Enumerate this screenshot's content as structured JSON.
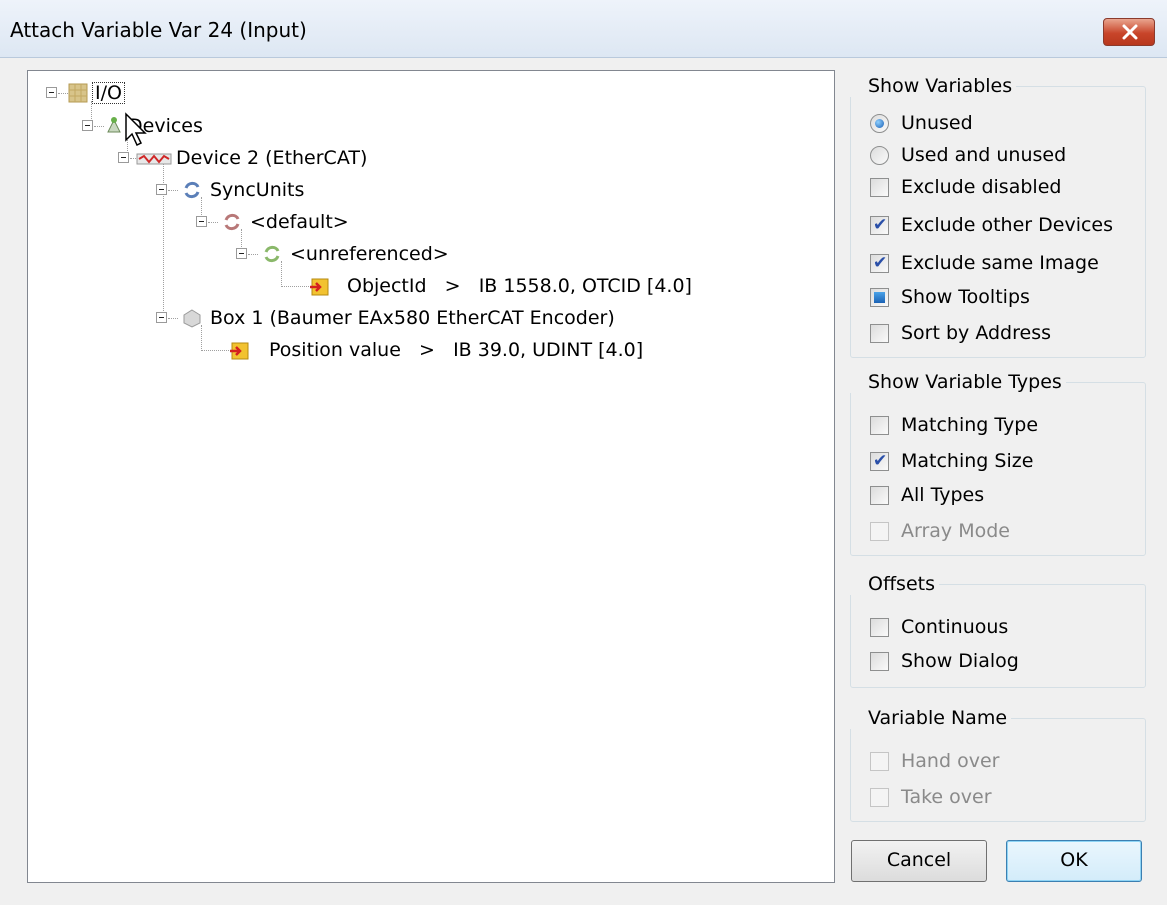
{
  "window": {
    "title": "Attach Variable Var 24 (Input)",
    "close_label": "x"
  },
  "tree": {
    "io": "I/O",
    "devices": "Devices",
    "device2": "Device 2 (EtherCAT)",
    "syncunits": "SyncUnits",
    "default": "<default>",
    "unreferenced": "<unreferenced>",
    "objectid": "ObjectId   >   IB 1558.0, OTCID [4.0]",
    "box1": "Box 1 (Baumer EAx580 EtherCAT Encoder)",
    "position": "Position value   >   IB 39.0, UDINT [4.0]"
  },
  "show_variables": {
    "title": "Show Variables",
    "unused": "Unused",
    "used_unused": "Used and unused",
    "exclude_disabled": "Exclude disabled",
    "exclude_other": "Exclude other Devices",
    "exclude_same": "Exclude same Image",
    "show_tooltips": "Show Tooltips",
    "sort_address": "Sort by Address"
  },
  "show_types": {
    "title": "Show Variable Types",
    "matching_type": "Matching Type",
    "matching_size": "Matching Size",
    "all_types": "All Types",
    "array_mode": "Array Mode"
  },
  "offsets": {
    "title": "Offsets",
    "continuous": "Continuous",
    "show_dialog": "Show Dialog"
  },
  "variable_name": {
    "title": "Variable Name",
    "hand_over": "Hand over",
    "take_over": "Take over"
  },
  "buttons": {
    "cancel": "Cancel",
    "ok": "OK"
  },
  "colors": {
    "accent": "#1b62b5",
    "close": "#c8452a",
    "io_icon": "#c8b27a",
    "var_icon": "#e8a81e"
  }
}
